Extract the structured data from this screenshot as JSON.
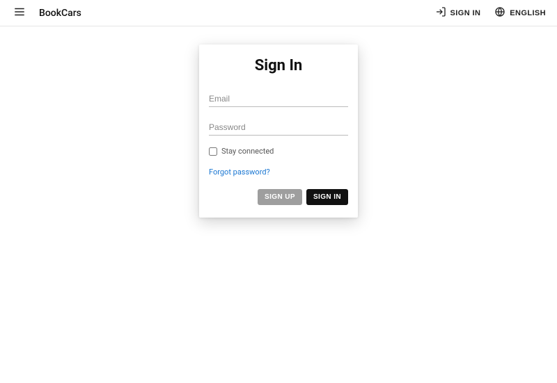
{
  "header": {
    "brand": "BookCars",
    "sign_in": "SIGN IN",
    "language": "ENGLISH"
  },
  "card": {
    "title": "Sign In",
    "email_placeholder": "Email",
    "password_placeholder": "Password",
    "stay_connected": "Stay connected",
    "forgot": "Forgot password?",
    "signup_btn": "SIGN UP",
    "signin_btn": "SIGN IN"
  }
}
